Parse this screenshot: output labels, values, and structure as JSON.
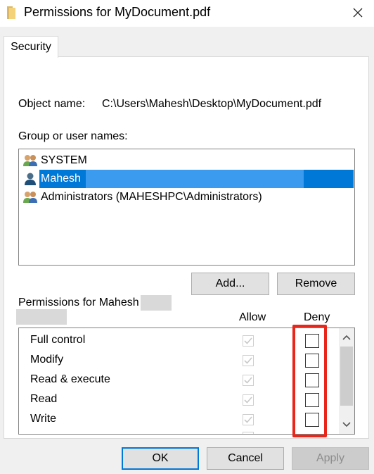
{
  "window": {
    "title": "Permissions for MyDocument.pdf",
    "icon": "folder-icon",
    "close_icon": "close-icon"
  },
  "tabs": [
    {
      "label": "Security",
      "active": true
    }
  ],
  "object": {
    "label": "Object name:",
    "value": "C:\\Users\\Mahesh\\Desktop\\MyDocument.pdf"
  },
  "users": {
    "label": "Group or user names:",
    "items": [
      {
        "name": "SYSTEM",
        "icon": "group-icon",
        "selected": false
      },
      {
        "name": "Mahesh",
        "icon": "user-icon",
        "selected": true
      },
      {
        "name": "Administrators (MAHESHPC\\Administrators)",
        "icon": "group-icon",
        "selected": false
      }
    ]
  },
  "user_buttons": {
    "add": "Add...",
    "remove": "Remove"
  },
  "permissions": {
    "label": "Permissions for Mahesh",
    "allow_header": "Allow",
    "deny_header": "Deny",
    "rows": [
      {
        "name": "Full control",
        "allow": true,
        "deny": false
      },
      {
        "name": "Modify",
        "allow": true,
        "deny": false
      },
      {
        "name": "Read & execute",
        "allow": true,
        "deny": false
      },
      {
        "name": "Read",
        "allow": true,
        "deny": false
      },
      {
        "name": "Write",
        "allow": true,
        "deny": false
      }
    ]
  },
  "dialog_buttons": {
    "ok": "OK",
    "cancel": "Cancel",
    "apply": "Apply"
  },
  "colors": {
    "selection": "#0078d7",
    "highlight": "#e8261a"
  }
}
